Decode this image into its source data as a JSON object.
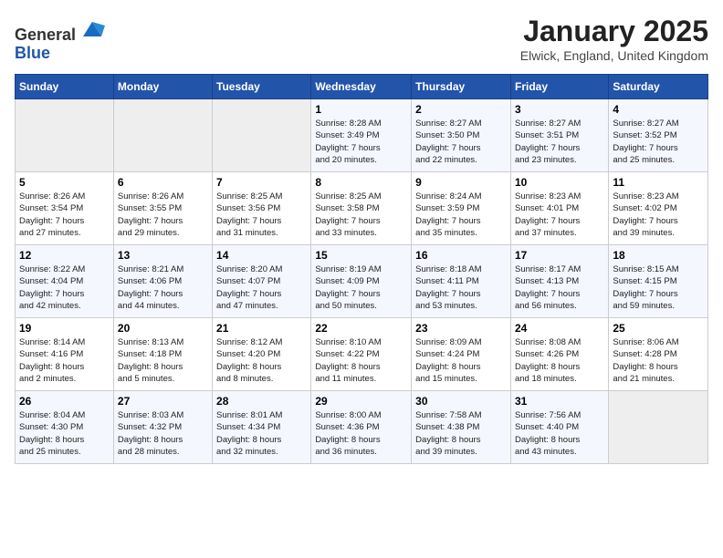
{
  "header": {
    "logo_line1": "General",
    "logo_line2": "Blue",
    "title": "January 2025",
    "subtitle": "Elwick, England, United Kingdom"
  },
  "days_of_week": [
    "Sunday",
    "Monday",
    "Tuesday",
    "Wednesday",
    "Thursday",
    "Friday",
    "Saturday"
  ],
  "weeks": [
    [
      {
        "day": "",
        "detail": ""
      },
      {
        "day": "",
        "detail": ""
      },
      {
        "day": "",
        "detail": ""
      },
      {
        "day": "1",
        "detail": "Sunrise: 8:28 AM\nSunset: 3:49 PM\nDaylight: 7 hours\nand 20 minutes."
      },
      {
        "day": "2",
        "detail": "Sunrise: 8:27 AM\nSunset: 3:50 PM\nDaylight: 7 hours\nand 22 minutes."
      },
      {
        "day": "3",
        "detail": "Sunrise: 8:27 AM\nSunset: 3:51 PM\nDaylight: 7 hours\nand 23 minutes."
      },
      {
        "day": "4",
        "detail": "Sunrise: 8:27 AM\nSunset: 3:52 PM\nDaylight: 7 hours\nand 25 minutes."
      }
    ],
    [
      {
        "day": "5",
        "detail": "Sunrise: 8:26 AM\nSunset: 3:54 PM\nDaylight: 7 hours\nand 27 minutes."
      },
      {
        "day": "6",
        "detail": "Sunrise: 8:26 AM\nSunset: 3:55 PM\nDaylight: 7 hours\nand 29 minutes."
      },
      {
        "day": "7",
        "detail": "Sunrise: 8:25 AM\nSunset: 3:56 PM\nDaylight: 7 hours\nand 31 minutes."
      },
      {
        "day": "8",
        "detail": "Sunrise: 8:25 AM\nSunset: 3:58 PM\nDaylight: 7 hours\nand 33 minutes."
      },
      {
        "day": "9",
        "detail": "Sunrise: 8:24 AM\nSunset: 3:59 PM\nDaylight: 7 hours\nand 35 minutes."
      },
      {
        "day": "10",
        "detail": "Sunrise: 8:23 AM\nSunset: 4:01 PM\nDaylight: 7 hours\nand 37 minutes."
      },
      {
        "day": "11",
        "detail": "Sunrise: 8:23 AM\nSunset: 4:02 PM\nDaylight: 7 hours\nand 39 minutes."
      }
    ],
    [
      {
        "day": "12",
        "detail": "Sunrise: 8:22 AM\nSunset: 4:04 PM\nDaylight: 7 hours\nand 42 minutes."
      },
      {
        "day": "13",
        "detail": "Sunrise: 8:21 AM\nSunset: 4:06 PM\nDaylight: 7 hours\nand 44 minutes."
      },
      {
        "day": "14",
        "detail": "Sunrise: 8:20 AM\nSunset: 4:07 PM\nDaylight: 7 hours\nand 47 minutes."
      },
      {
        "day": "15",
        "detail": "Sunrise: 8:19 AM\nSunset: 4:09 PM\nDaylight: 7 hours\nand 50 minutes."
      },
      {
        "day": "16",
        "detail": "Sunrise: 8:18 AM\nSunset: 4:11 PM\nDaylight: 7 hours\nand 53 minutes."
      },
      {
        "day": "17",
        "detail": "Sunrise: 8:17 AM\nSunset: 4:13 PM\nDaylight: 7 hours\nand 56 minutes."
      },
      {
        "day": "18",
        "detail": "Sunrise: 8:15 AM\nSunset: 4:15 PM\nDaylight: 7 hours\nand 59 minutes."
      }
    ],
    [
      {
        "day": "19",
        "detail": "Sunrise: 8:14 AM\nSunset: 4:16 PM\nDaylight: 8 hours\nand 2 minutes."
      },
      {
        "day": "20",
        "detail": "Sunrise: 8:13 AM\nSunset: 4:18 PM\nDaylight: 8 hours\nand 5 minutes."
      },
      {
        "day": "21",
        "detail": "Sunrise: 8:12 AM\nSunset: 4:20 PM\nDaylight: 8 hours\nand 8 minutes."
      },
      {
        "day": "22",
        "detail": "Sunrise: 8:10 AM\nSunset: 4:22 PM\nDaylight: 8 hours\nand 11 minutes."
      },
      {
        "day": "23",
        "detail": "Sunrise: 8:09 AM\nSunset: 4:24 PM\nDaylight: 8 hours\nand 15 minutes."
      },
      {
        "day": "24",
        "detail": "Sunrise: 8:08 AM\nSunset: 4:26 PM\nDaylight: 8 hours\nand 18 minutes."
      },
      {
        "day": "25",
        "detail": "Sunrise: 8:06 AM\nSunset: 4:28 PM\nDaylight: 8 hours\nand 21 minutes."
      }
    ],
    [
      {
        "day": "26",
        "detail": "Sunrise: 8:04 AM\nSunset: 4:30 PM\nDaylight: 8 hours\nand 25 minutes."
      },
      {
        "day": "27",
        "detail": "Sunrise: 8:03 AM\nSunset: 4:32 PM\nDaylight: 8 hours\nand 28 minutes."
      },
      {
        "day": "28",
        "detail": "Sunrise: 8:01 AM\nSunset: 4:34 PM\nDaylight: 8 hours\nand 32 minutes."
      },
      {
        "day": "29",
        "detail": "Sunrise: 8:00 AM\nSunset: 4:36 PM\nDaylight: 8 hours\nand 36 minutes."
      },
      {
        "day": "30",
        "detail": "Sunrise: 7:58 AM\nSunset: 4:38 PM\nDaylight: 8 hours\nand 39 minutes."
      },
      {
        "day": "31",
        "detail": "Sunrise: 7:56 AM\nSunset: 4:40 PM\nDaylight: 8 hours\nand 43 minutes."
      },
      {
        "day": "",
        "detail": ""
      }
    ]
  ]
}
